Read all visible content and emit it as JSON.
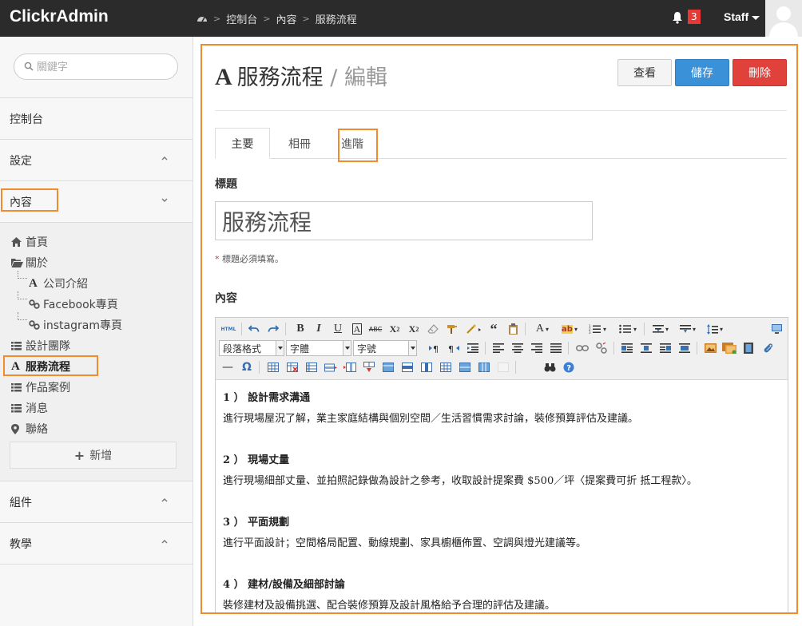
{
  "app": {
    "brand": "ClickrAdmin"
  },
  "breadcrumb": [
    "控制台",
    "內容",
    "服務流程"
  ],
  "header": {
    "notification_count": "3",
    "user_label": "Staff"
  },
  "sidebar": {
    "search_placeholder": "關鍵字",
    "sections": {
      "dashboard": "控制台",
      "settings": "設定",
      "content": "內容",
      "components": "組件",
      "tutorial": "教學"
    },
    "content_items": [
      {
        "label": "首頁",
        "icon": "home-icon"
      },
      {
        "label": "關於",
        "icon": "folder-open-icon"
      },
      {
        "label": "公司介紹",
        "icon": "font-icon"
      },
      {
        "label": "Facebook專頁",
        "icon": "link-icon"
      },
      {
        "label": "instagram專頁",
        "icon": "link-icon"
      },
      {
        "label": "設計團隊",
        "icon": "list-icon"
      },
      {
        "label": "服務流程",
        "icon": "font-icon"
      },
      {
        "label": "作品案例",
        "icon": "list-icon"
      },
      {
        "label": "消息",
        "icon": "list-icon"
      },
      {
        "label": "聯絡",
        "icon": "map-marker-icon"
      }
    ],
    "add_label": "新增"
  },
  "page": {
    "title": "服務流程",
    "mode": "編輯",
    "buttons": {
      "view": "查看",
      "save": "儲存",
      "delete": "刪除"
    },
    "tabs": [
      "主要",
      "相冊",
      "進階"
    ],
    "title_field": {
      "label": "標題",
      "value": "服務流程",
      "help": "標題必須填寫。",
      "required_mark": "*"
    },
    "content_field": {
      "label": "內容"
    }
  },
  "editor": {
    "selects": {
      "format": "段落格式",
      "font": "字體",
      "size": "字號"
    },
    "source_label": "HTML",
    "content": [
      {
        "heading": "1 ） 設計需求溝通",
        "text": "進行現場屋況了解，業主家庭結構與個別空間／生活習慣需求討論，裝修預算評估及建議。"
      },
      {
        "heading": "2 ） 現場丈量",
        "text": "進行現場細部丈量、並拍照記錄做為設計之參考，收取設計提案費 $500／坪〈提案費可折 抵工程款〉。"
      },
      {
        "heading": "3 ） 平面規劃",
        "text": "進行平面設計；空間格局配置、動線規劃、家具櫥櫃佈置、空調與燈光建議等。"
      },
      {
        "heading": "4 ） 建材/設備及細部討論",
        "text": "裝修建材及設備挑選、配合裝修預算及設計風格給予合理的評估及建議。"
      }
    ]
  },
  "colors": {
    "topbar": "#2b2b2b",
    "highlight": "#f28a2e",
    "save": "#3b91d8",
    "delete": "#e0413b",
    "badge": "#e53935"
  }
}
